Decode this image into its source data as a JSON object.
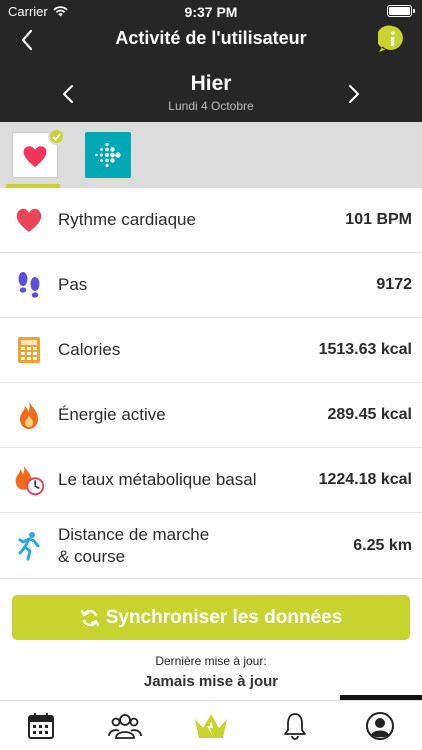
{
  "status_bar": {
    "carrier": "Carrier",
    "time": "9:37 PM"
  },
  "header": {
    "title": "Activité de l'utilisateur"
  },
  "date": {
    "main": "Hier",
    "sub": "Lundi 4 Octobre"
  },
  "sources": [
    {
      "name": "Apple Health",
      "icon": "health-heart-icon",
      "selected": true
    },
    {
      "name": "Fitbit",
      "icon": "fitbit-logo-icon",
      "selected": false
    }
  ],
  "metrics": [
    {
      "label": "Rythme cardiaque",
      "value": "101 BPM",
      "icon": "heart-icon",
      "color": "#e8455b"
    },
    {
      "label": "Pas",
      "value": "9172",
      "icon": "footsteps-icon",
      "color": "#5b4fd6"
    },
    {
      "label": "Calories",
      "value": "1513.63 kcal",
      "icon": "calculator-icon",
      "color": "#f2a22c"
    },
    {
      "label": "Énergie active",
      "value": "289.45 kcal",
      "icon": "flame-icon",
      "color": "#f26a1b"
    },
    {
      "label": "Le taux métabolique basal",
      "value": "1224.18 kcal",
      "icon": "flame-clock-icon",
      "color": "#f26a1b"
    },
    {
      "label_line1": "Distance de marche",
      "label_line2": "& course",
      "value": "6.25 km",
      "icon": "runner-icon",
      "color": "#2aa8e0"
    }
  ],
  "sync_button": {
    "label": "Synchroniser les données"
  },
  "last_update": {
    "label": "Dernière mise à jour:",
    "value": "Jamais mise à jour"
  },
  "tabbar": [
    {
      "icon": "calendar-icon"
    },
    {
      "icon": "group-icon"
    },
    {
      "icon": "crown-icon",
      "active": true
    },
    {
      "icon": "bell-icon"
    },
    {
      "icon": "profile-icon"
    }
  ],
  "colors": {
    "accent": "#c8d330",
    "header_bg": "#262626"
  }
}
